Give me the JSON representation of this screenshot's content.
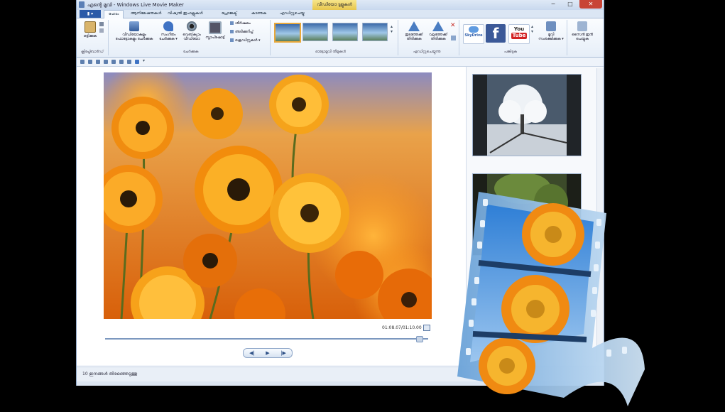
{
  "window": {
    "title": "എന്റെ മൂവി - Windows Live Movie Maker",
    "context_tab": "വീഡിയോ ടൂളുകൾ",
    "minimize": "─",
    "maximize": "□",
    "close": "✕"
  },
  "menu": {
    "file_label": "▮ ▾",
    "tabs": [
      {
        "label": "ഹോം",
        "active": true
      },
      {
        "label": "ആനിമേഷനുകൾ"
      },
      {
        "label": "വിഷ്വൽ ഇഫക്റ്റുകൾ"
      },
      {
        "label": "പ്രോജക്ട്"
      },
      {
        "label": "കാണുക"
      },
      {
        "label": "എഡിറ്റുചെയ്യൂ"
      }
    ]
  },
  "ribbon": {
    "clipboard": {
      "paste": "ഒട്ടിക്കുക",
      "group": "ക്ലിപ്പ്ബോർഡ്"
    },
    "add": {
      "add_videos": "വീഡിയോകളും ഫോട്ടോകളും ചേർക്കുക",
      "add_music": "സംഗീതം ചേർക്കുക ▾",
      "webcam": "വെബ്‌ക്യാം വീഡിയോ",
      "snapshot": "സ്നാപ്ഷോട്ട്",
      "title": "ശീർഷകം",
      "caption": "അടിക്കുറിപ്പ്",
      "credits": "ക്രെഡിറ്റുകൾ ▾",
      "group": "ചേർക്കുക"
    },
    "themes": {
      "group": "ഓട്ടോമൂവി തീമുകൾ"
    },
    "editing": {
      "rotate_left": "ഇടത്തേക്ക് തിരിക്കുക",
      "rotate_right": "വലത്തേക്ക് തിരിക്കുക",
      "group": "എഡിറ്റുചെയ്യുന്നു"
    },
    "share": {
      "skydrive": "SkyDrive",
      "facebook": "f",
      "youtube_top": "You",
      "youtube_bottom": "Tube",
      "save_movie": "മൂവി സംരക്ഷിക്കുക ▾",
      "sign_in": "സൈൻ ഇൻ ചെയ്യുക",
      "group": "പങ്കിടുക"
    }
  },
  "player": {
    "timecode": "01:08.07/01:10.00",
    "prev": "◀|",
    "play": "▶",
    "next": "|▶"
  },
  "status": {
    "text": "10 ഇനങ്ങൾ തിരഞ്ഞെടുത്തു"
  },
  "colors": {
    "accent": "#2a5aa8",
    "close_button": "#c84436",
    "facebook": "#3b5998",
    "youtube_red": "#d32424"
  }
}
